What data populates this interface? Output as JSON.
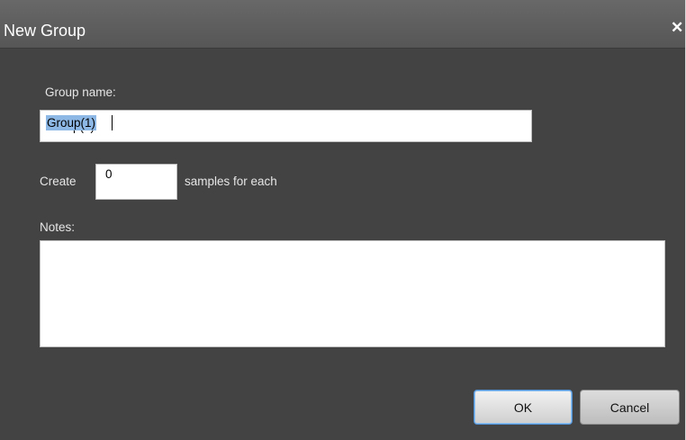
{
  "dialog": {
    "title": "New Group",
    "close_glyph": "✕",
    "close_icon": "close-icon"
  },
  "group_name": {
    "label": "Group name:",
    "value": "Group(1)",
    "selected": true
  },
  "samples": {
    "prefix_label": "Create",
    "value": "0",
    "suffix_label": "samples for each"
  },
  "notes": {
    "label": "Notes:",
    "value": ""
  },
  "buttons": {
    "ok_label": "OK",
    "cancel_label": "Cancel"
  },
  "colors": {
    "dialog_background": "#434343",
    "titlebar": "#606060",
    "selection_highlight": "#8db8e6",
    "default_button_border": "#4f8fd3"
  }
}
